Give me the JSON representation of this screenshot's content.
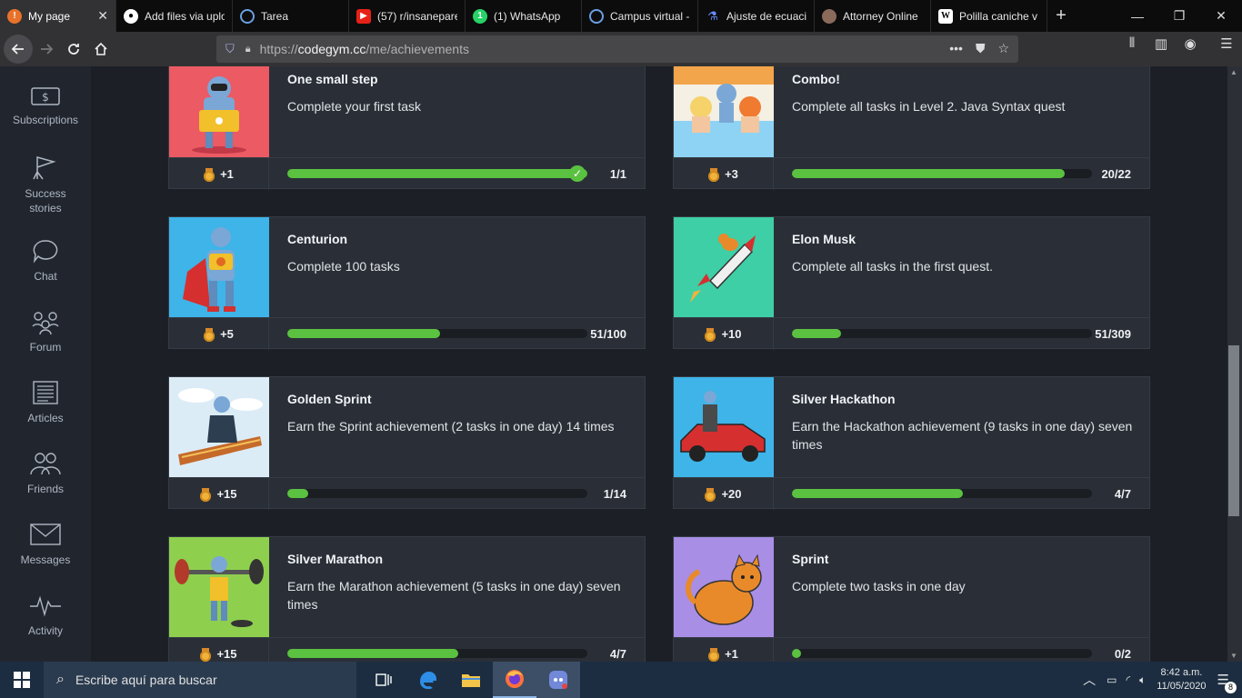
{
  "browser": {
    "tabs": [
      {
        "label": "My page",
        "favicon": "codegym-icon",
        "color": "#e8722a",
        "active": true
      },
      {
        "label": "Add files via uplo",
        "favicon": "github-icon",
        "color": "#000000"
      },
      {
        "label": "Tarea",
        "favicon": "moodle-icon",
        "color": "#2b6cb0"
      },
      {
        "label": "(57) r/insanepare",
        "favicon": "youtube-icon",
        "color": "#e62117"
      },
      {
        "label": "(1) WhatsApp",
        "favicon": "whatsapp-icon",
        "color": "#25d366"
      },
      {
        "label": "Campus virtual -",
        "favicon": "moodle-icon",
        "color": "#2b6cb0"
      },
      {
        "label": "Ajuste de ecuaci",
        "favicon": "flask-icon",
        "color": "#3b5bdb"
      },
      {
        "label": "Attorney Online",
        "favicon": "avatar-icon",
        "color": "#8a6a5a"
      },
      {
        "label": "Polilla caniche v",
        "favicon": "wikipedia-icon",
        "color": "#ffffff"
      }
    ],
    "url_prefix": "https://",
    "url_host": "codegym.cc",
    "url_path": "/me/achievements"
  },
  "sidebar": {
    "items": [
      {
        "label": "Subscriptions",
        "icon": "dollar-icon"
      },
      {
        "label": "Success stories",
        "icon": "flag-icon"
      },
      {
        "label": "Chat",
        "icon": "chat-icon"
      },
      {
        "label": "Forum",
        "icon": "forum-icon"
      },
      {
        "label": "Articles",
        "icon": "articles-icon"
      },
      {
        "label": "Friends",
        "icon": "friends-icon"
      },
      {
        "label": "Messages",
        "icon": "envelope-icon"
      },
      {
        "label": "Activity",
        "icon": "activity-icon"
      }
    ]
  },
  "achievements": [
    {
      "title": "One small step",
      "description": "Complete your first task",
      "reward": "+1",
      "progress": "1/1",
      "fraction": 1.0,
      "completed": true,
      "bg": "#ec5a64"
    },
    {
      "title": "Combo!",
      "description": "Complete all tasks in Level 2. Java Syntax quest",
      "reward": "+3",
      "progress": "20/22",
      "fraction": 0.909,
      "completed": false,
      "bg": "#f4f0e4"
    },
    {
      "title": "Centurion",
      "description": "Complete 100 tasks",
      "reward": "+5",
      "progress": "51/100",
      "fraction": 0.51,
      "completed": false,
      "bg": "#3eb4e8"
    },
    {
      "title": "Elon Musk",
      "description": "Complete all tasks in the first quest.",
      "reward": "+10",
      "progress": "51/309",
      "fraction": 0.165,
      "completed": false,
      "bg": "#3ecfa6"
    },
    {
      "title": "Golden Sprint",
      "description": "Earn the Sprint achievement (2 tasks in one day) 14 times",
      "reward": "+15",
      "progress": "1/14",
      "fraction": 0.071,
      "completed": false,
      "bg": "#dcecf6"
    },
    {
      "title": "Silver Hackathon",
      "description": "Earn the Hackathon achievement (9 tasks in one day) seven times",
      "reward": "+20",
      "progress": "4/7",
      "fraction": 0.571,
      "completed": false,
      "bg": "#3eb4e8"
    },
    {
      "title": "Silver Marathon",
      "description": "Earn the Marathon achievement (5 tasks in one day) seven times",
      "reward": "+15",
      "progress": "4/7",
      "fraction": 0.571,
      "completed": false,
      "bg": "#8ed04e"
    },
    {
      "title": "Sprint",
      "description": "Complete two tasks in one day",
      "reward": "+1",
      "progress": "0/2",
      "fraction": 0.0,
      "completed": false,
      "bg": "#a98ee6"
    }
  ],
  "taskbar": {
    "search_placeholder": "Escribe aquí para buscar",
    "time": "8:42 a.m.",
    "date": "11/05/2020",
    "notifications": "8"
  },
  "colors": {
    "accent_green": "#5bc140",
    "card_bg": "#2a2f37",
    "sidebar_bg": "#21262e"
  }
}
